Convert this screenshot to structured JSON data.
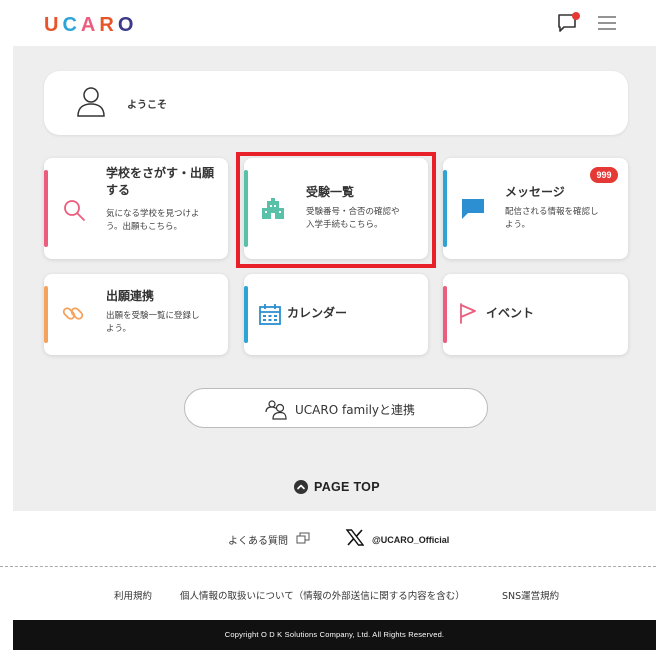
{
  "header": {
    "logo_letters": [
      "U",
      "C",
      "A",
      "R",
      "O"
    ],
    "logo_colors": [
      "#e8552b",
      "#2da3d6",
      "#ec5d7d",
      "#e8552b",
      "#3e3a8a"
    ]
  },
  "welcome": {
    "text": "ようこそ"
  },
  "cards": [
    {
      "title_lines": [
        "学校をさがす・出願",
        "する"
      ],
      "desc_lines": [
        "気になる学校を見つけよ",
        "う。出願もこちら。"
      ],
      "accent": "#ec5d7d",
      "icon": "search-icon"
    },
    {
      "title_lines": [
        "受験一覧"
      ],
      "desc_lines": [
        "受験番号・合否の確認や",
        "入学手続もこちら。"
      ],
      "accent": "#58c1a8",
      "icon": "school-icon"
    },
    {
      "title_lines": [
        "メッセージ"
      ],
      "desc_lines": [
        "配信される情報を確認し",
        "よう。"
      ],
      "accent": "#2da3d6",
      "icon": "message-icon",
      "badge": "999"
    },
    {
      "title_lines": [
        "出願連携"
      ],
      "desc_lines": [
        "出願を受験一覧に登録し",
        "よう。"
      ],
      "accent": "#f5a25d",
      "icon": "link-icon"
    },
    {
      "title_lines": [
        "カレンダー"
      ],
      "desc_lines": [],
      "accent": "#2da3d6",
      "icon": "calendar-icon"
    },
    {
      "title_lines": [
        "イベント"
      ],
      "desc_lines": [],
      "accent": "#ec5d7d",
      "icon": "flag-icon"
    }
  ],
  "family_button": {
    "label": "UCARO familyと連携"
  },
  "page_top": {
    "label": "PAGE TOP"
  },
  "faq": {
    "label": "よくある質問"
  },
  "twitter": {
    "handle": "@UCARO_Official"
  },
  "footer_links": [
    "利用規約",
    "個人情報の取扱いについて（情報の外部送信に関する内容を含む）",
    "SNS運営規約"
  ],
  "copyright": "Copyright O D K Solutions Company, Ltd. All Rights Reserved."
}
